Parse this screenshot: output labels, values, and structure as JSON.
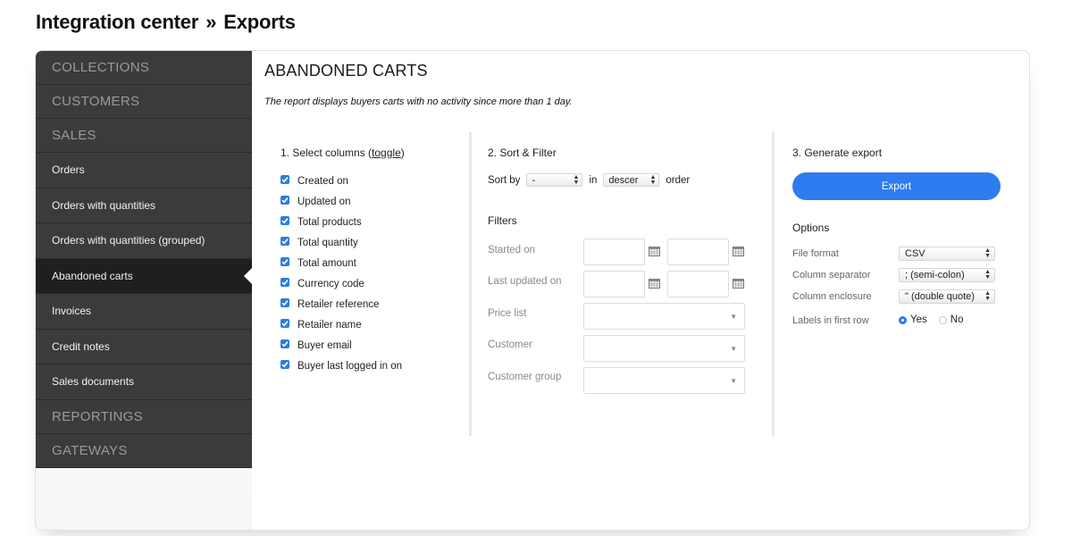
{
  "header": {
    "crumb_parent": "Integration center",
    "crumb_separator": "»",
    "crumb_current": "Exports"
  },
  "sidebar": {
    "items": [
      {
        "label": "COLLECTIONS",
        "kind": "section"
      },
      {
        "label": "CUSTOMERS",
        "kind": "section"
      },
      {
        "label": "SALES",
        "kind": "section"
      },
      {
        "label": "Orders",
        "kind": "sub"
      },
      {
        "label": "Orders with quantities",
        "kind": "sub"
      },
      {
        "label": "Orders with quantities (grouped)",
        "kind": "sub"
      },
      {
        "label": "Abandoned carts",
        "kind": "sub",
        "active": true
      },
      {
        "label": "Invoices",
        "kind": "sub"
      },
      {
        "label": "Credit notes",
        "kind": "sub"
      },
      {
        "label": "Sales documents",
        "kind": "sub"
      },
      {
        "label": "REPORTINGS",
        "kind": "section"
      },
      {
        "label": "GATEWAYS",
        "kind": "section"
      }
    ]
  },
  "main": {
    "title": "ABANDONED CARTS",
    "description": "The report displays buyers carts with no activity since more than 1 day.",
    "columns_section": {
      "title_prefix": "1. Select columns (",
      "toggle_label": "toggle",
      "title_suffix": ")",
      "items": [
        {
          "label": "Created on",
          "checked": true
        },
        {
          "label": "Updated on",
          "checked": true
        },
        {
          "label": "Total products",
          "checked": true
        },
        {
          "label": "Total quantity",
          "checked": true
        },
        {
          "label": "Total amount",
          "checked": true
        },
        {
          "label": "Currency code",
          "checked": true
        },
        {
          "label": "Retailer reference",
          "checked": true
        },
        {
          "label": "Retailer name",
          "checked": true
        },
        {
          "label": "Buyer email",
          "checked": true
        },
        {
          "label": "Buyer last logged in on",
          "checked": true
        }
      ]
    },
    "sort_filter": {
      "title": "2. Sort & Filter",
      "sort_by_label": "Sort by",
      "sort_by_value": "-",
      "in_label": "in",
      "order_value": "descer",
      "order_label": "order",
      "filters_title": "Filters",
      "started_on_label": "Started on",
      "last_updated_label": "Last updated on",
      "price_list_label": "Price list",
      "customer_label": "Customer",
      "customer_group_label": "Customer group"
    },
    "generate": {
      "title": "3. Generate export",
      "export_label": "Export",
      "options_title": "Options",
      "file_format_label": "File format",
      "file_format_value": "CSV",
      "column_separator_label": "Column separator",
      "column_separator_value": "; (semi-colon)",
      "column_enclosure_label": "Column enclosure",
      "column_enclosure_value": "\" (double quote)",
      "labels_first_row_label": "Labels in first row",
      "yes_label": "Yes",
      "no_label": "No",
      "labels_first_row_selected": "Yes"
    }
  },
  "colors": {
    "accent": "#2d7cf0",
    "sidebar_bg": "#3b3b3b",
    "sidebar_active": "#1f1f1f"
  }
}
